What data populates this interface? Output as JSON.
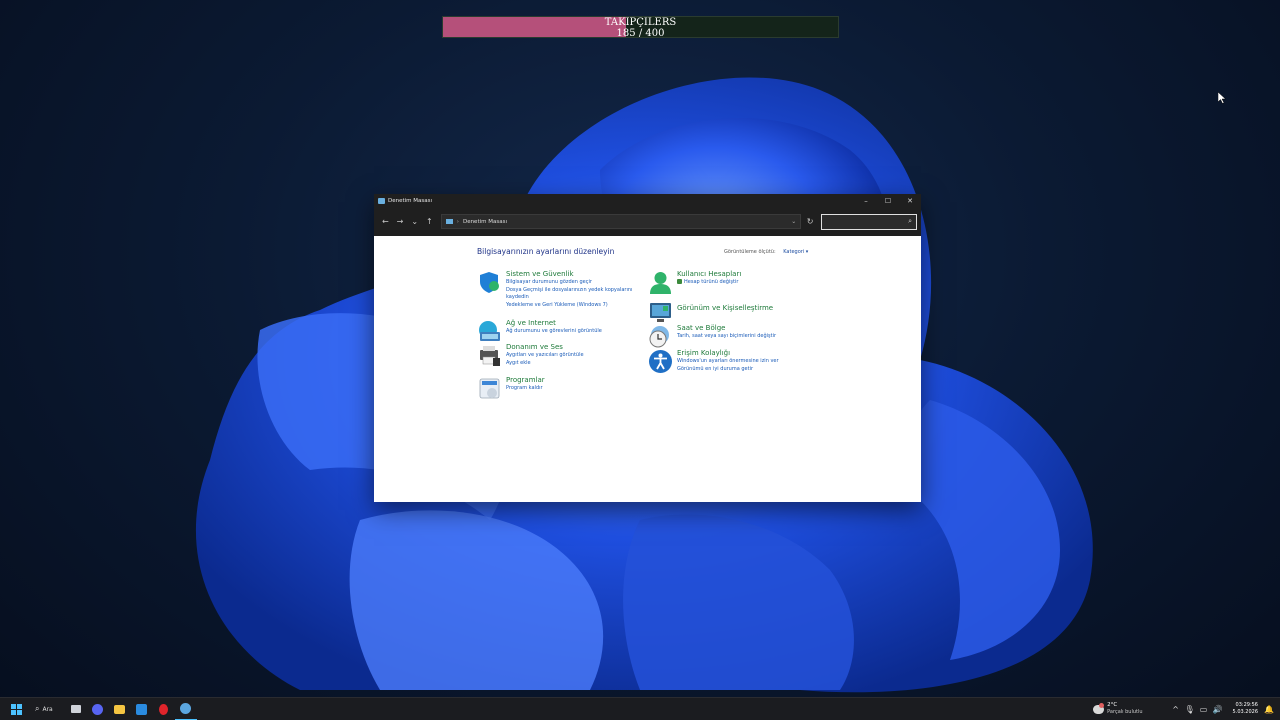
{
  "overlay": {
    "label": "TAKİPÇİLERS",
    "current": "185",
    "separator": "/",
    "goal": "400",
    "progress": 0.4625
  },
  "window": {
    "title": "Denetim Masası",
    "controls": {
      "minimize": "–",
      "maximize": "☐",
      "close": "✕"
    },
    "nav": {
      "back": "←",
      "forward": "→",
      "recent": "⌄",
      "up": "↑"
    },
    "address": {
      "separator": "›",
      "path": "Denetim Masası",
      "dropdown": "⌄"
    },
    "refresh": "↻",
    "search_icon": "⌕",
    "heading": "Bilgisayarınızın ayarlarını düzenleyin",
    "view_by": {
      "label": "Görüntüleme ölçütü:",
      "value": "Kategori ▾"
    },
    "left_categories": [
      {
        "title": "Sistem ve Güvenlik",
        "icon": "shield-icon",
        "links": [
          "Bilgisayar durumunu gözden geçir",
          "Dosya Geçmişi ile dosyalarınızın yedek kopyalarını kaydedin",
          "Yedekleme ve Geri Yükleme (Windows 7)"
        ]
      },
      {
        "title": "Ağ ve Internet",
        "icon": "network-icon",
        "links": [
          "Ağ durumunu ve görevlerini görüntüle"
        ]
      },
      {
        "title": "Donanım ve Ses",
        "icon": "printer-icon",
        "links": [
          "Aygıtları ve yazıcıları görüntüle",
          "Aygıt ekle"
        ]
      },
      {
        "title": "Programlar",
        "icon": "programs-icon",
        "links": [
          "Program kaldır"
        ]
      }
    ],
    "right_categories": [
      {
        "title": "Kullanıcı Hesapları",
        "icon": "user-icon",
        "links": [
          "Hesap türünü değiştir"
        ]
      },
      {
        "title": "Görünüm ve Kişiselleştirme",
        "icon": "appearance-icon",
        "links": []
      },
      {
        "title": "Saat ve Bölge",
        "icon": "clock-icon",
        "links": [
          "Tarih, saat veya sayı biçimlerini değiştir"
        ]
      },
      {
        "title": "Erişim Kolaylığı",
        "icon": "accessibility-icon",
        "links": [
          "Windows'un ayarları önermesine izin ver",
          "Görünümü en iyi duruma getir"
        ]
      }
    ]
  },
  "taskbar": {
    "search_label": "Ara",
    "weather": {
      "temp": "2°C",
      "desc": "Parçalı bulutlu"
    },
    "tray_icons": {
      "chevron": "^",
      "mic": "🎙",
      "network": "▭",
      "volume": "🔊",
      "bell": "🔔"
    },
    "time": "03:29:56",
    "date": "5.03.2026"
  },
  "colors": {
    "accent": "#4cc2ff",
    "link_green": "#1e7a3a",
    "link_blue": "#1a5bb8",
    "heading_blue": "#1e3287",
    "overlay_fill": "#b5507a",
    "overlay_bg": "#14241a"
  }
}
